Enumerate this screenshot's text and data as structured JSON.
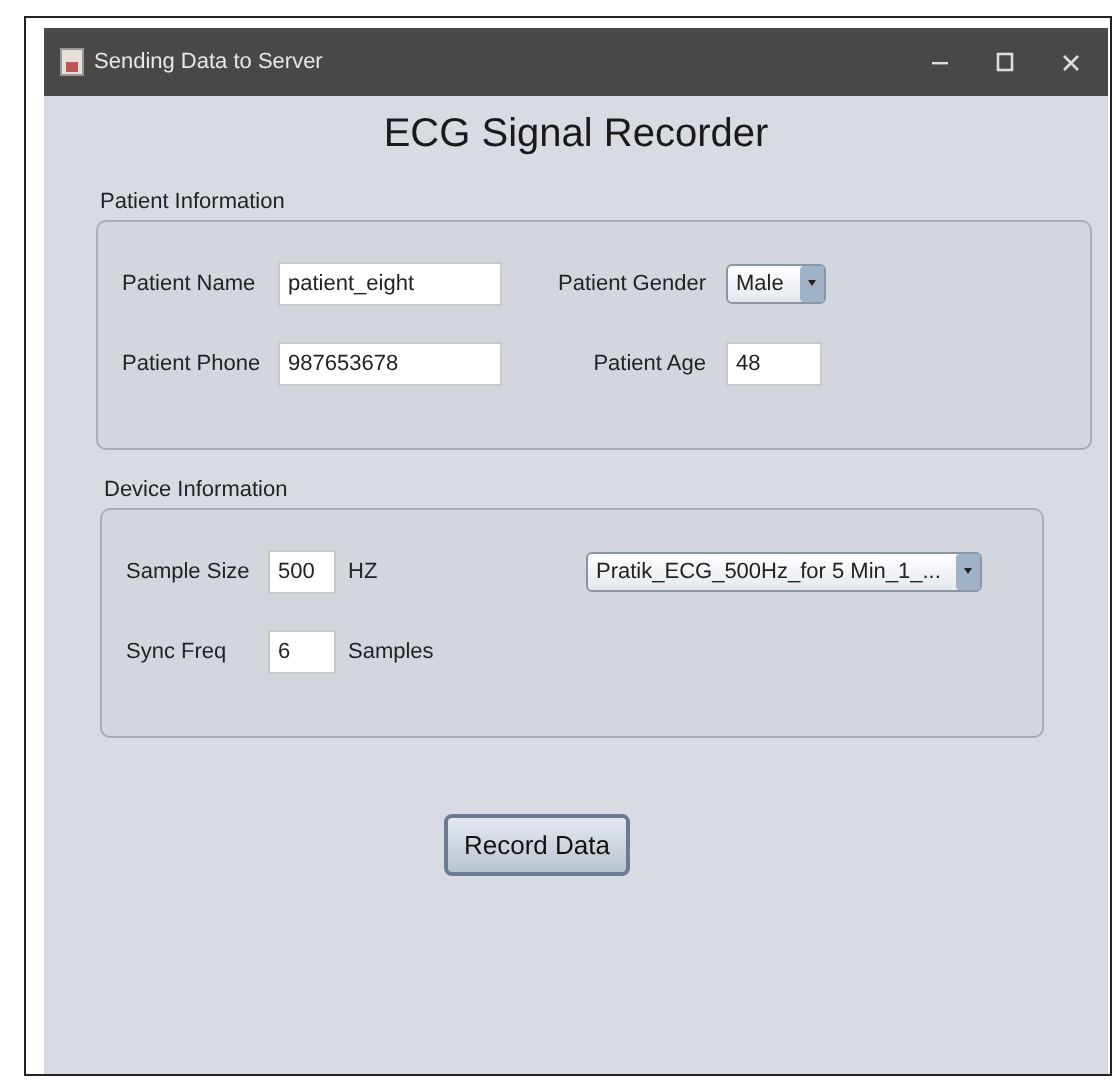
{
  "window": {
    "title": "Sending Data to Server"
  },
  "heading": "ECG Signal Recorder",
  "sections": [
    {
      "title": "Patient Information",
      "rows": [
        [
          {
            "kind": "label",
            "text": "Patient Name"
          },
          {
            "kind": "field",
            "value": "patient_eight"
          },
          {
            "kind": "label",
            "text": "Patient Gender"
          },
          {
            "kind": "combo",
            "value": "Male"
          }
        ],
        [
          {
            "kind": "label",
            "text": "Patient Phone"
          },
          {
            "kind": "field",
            "value": "987653678"
          },
          {
            "kind": "label",
            "text": "Patient Age"
          },
          {
            "kind": "field",
            "value": "48"
          }
        ]
      ]
    },
    {
      "title": "Device Information",
      "rows": [
        [
          {
            "kind": "label",
            "text": "Sample Size"
          },
          {
            "kind": "field",
            "value": "500"
          },
          {
            "kind": "unit",
            "text": "HZ"
          },
          {
            "kind": "combo",
            "value": "Pratik_ECG_500Hz_for 5 Min_1_..."
          }
        ],
        [
          {
            "kind": "label",
            "text": "Sync Freq"
          },
          {
            "kind": "field",
            "value": "6"
          },
          {
            "kind": "unit",
            "text": "Samples"
          }
        ]
      ]
    }
  ],
  "button": "Record Data"
}
